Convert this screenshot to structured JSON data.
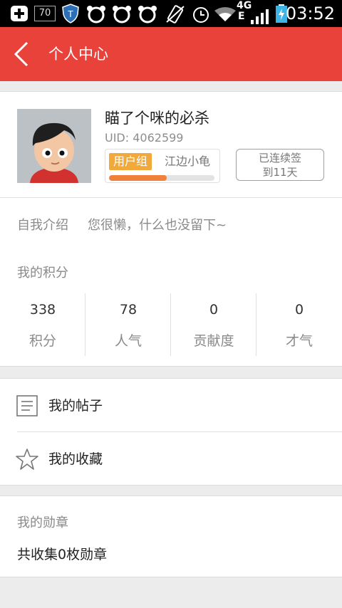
{
  "status_bar": {
    "time": "03:52",
    "notification_count": "70",
    "network": "4G",
    "network_sub": "E",
    "icons": [
      "add-icon",
      "notification-70-icon",
      "shield-icon",
      "bear-icon",
      "bear-icon",
      "bear-icon",
      "vibrate-icon",
      "alarm-icon",
      "wifi-icon",
      "signal-icon",
      "battery-icon"
    ]
  },
  "header": {
    "title": "个人中心"
  },
  "profile": {
    "nickname": "瞄了个咪的必杀",
    "uid": "UID: 4062599",
    "group_tag": "用户组",
    "group_name": "江边小龟",
    "exp_progress": 0.55,
    "checkin_line1": "已连续签",
    "checkin_line2": "到11天"
  },
  "intro": {
    "label": "自我介绍",
    "text": "您很懒，什么也没留下~"
  },
  "points": {
    "title": "我的积分",
    "stats": [
      {
        "value": "338",
        "label": "积分"
      },
      {
        "value": "78",
        "label": "人气"
      },
      {
        "value": "0",
        "label": "贡献度"
      },
      {
        "value": "0",
        "label": "才气"
      }
    ]
  },
  "menu": {
    "posts": "我的帖子",
    "favorites": "我的收藏"
  },
  "badges": {
    "title": "我的勋章",
    "summary": "共收集0枚勋章"
  },
  "colors": {
    "accent": "#e9423b",
    "group_tag": "#f2a93b",
    "progress": "#f0813a"
  }
}
